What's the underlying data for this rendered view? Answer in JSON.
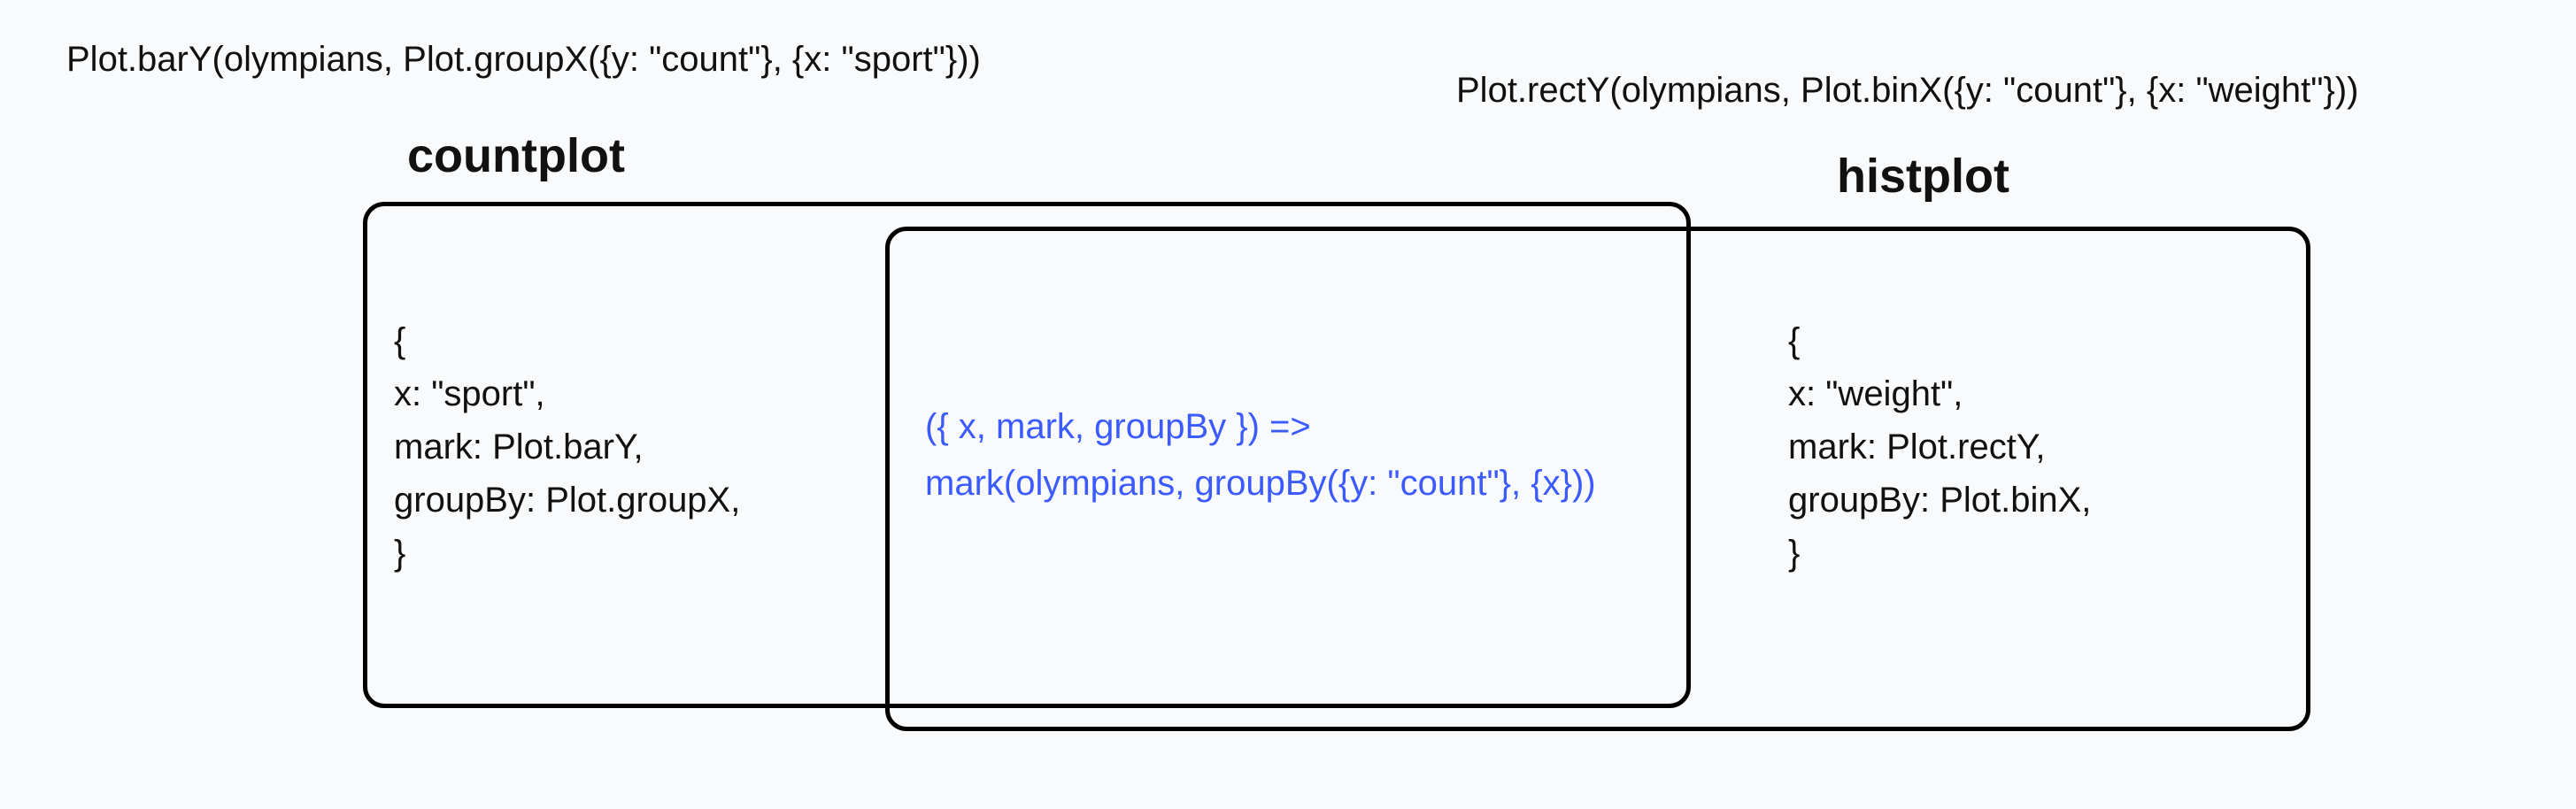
{
  "captions": {
    "left": "Plot.barY(olympians, Plot.groupX({y: \"count\"}, {x: \"sport\"}))",
    "right": "Plot.rectY(olympians, Plot.binX({y: \"count\"}, {x: \"weight\"}))"
  },
  "titles": {
    "left": "countplot",
    "right": "histplot"
  },
  "left_config": {
    "open": "{",
    "l1": "  x: \"sport\",",
    "l2": "  mark: Plot.barY,",
    "l3": "  groupBy: Plot.groupX,",
    "close": "}"
  },
  "right_config": {
    "open": "{",
    "l1": "  x: \"weight\",",
    "l2": "  mark: Plot.rectY,",
    "l3": "  groupBy: Plot.binX,",
    "close": "}"
  },
  "center_code": {
    "l1": "({ x, mark, groupBy }) =>",
    "l2": "      mark(olympians, groupBy({y: \"count\"}, {x}))"
  }
}
